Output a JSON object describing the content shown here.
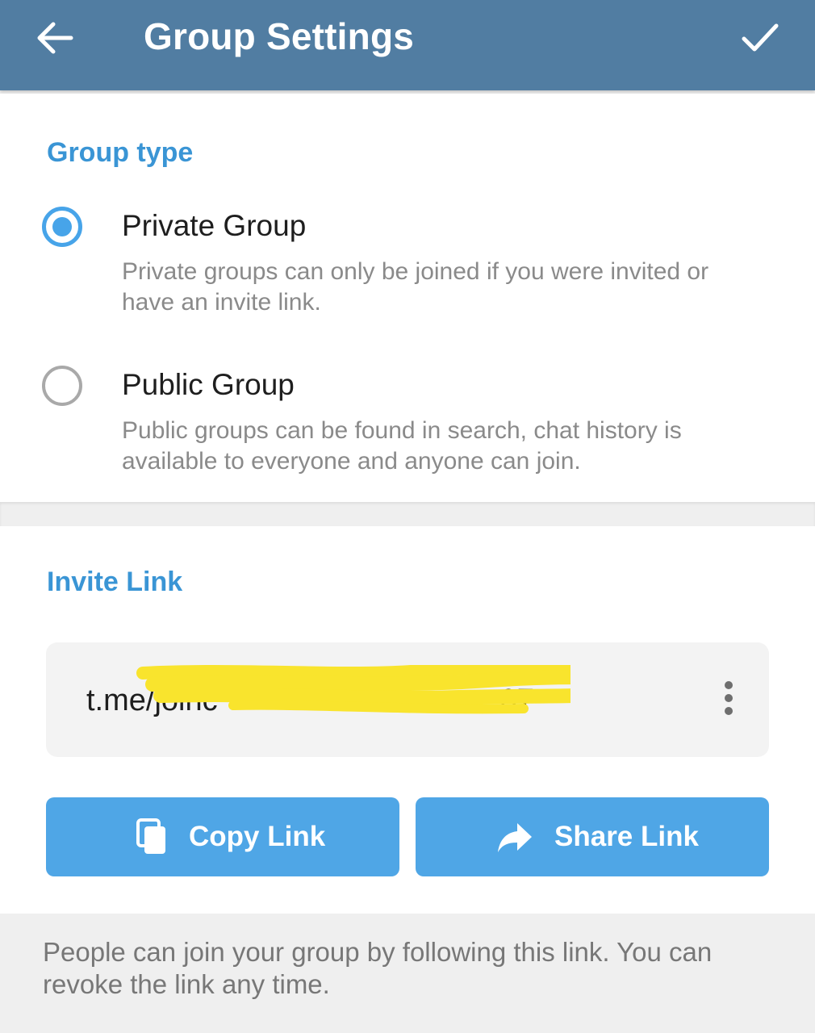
{
  "appbar": {
    "title": "Group Settings",
    "back_icon": "arrow-left-icon",
    "done_icon": "check-icon",
    "color": "#517da2"
  },
  "group_type": {
    "section_title": "Group type",
    "options": [
      {
        "label": "Private Group",
        "description": "Private groups can only be joined if you were invited or have an invite link.",
        "selected": true
      },
      {
        "label": "Public Group",
        "description": "Public groups can be found in search, chat history is available to everyone and anyone can join.",
        "selected": false
      }
    ]
  },
  "invite": {
    "section_title": "Invite Link",
    "link_text": "t.me/joinc",
    "link_suffix": "07",
    "redacted": true,
    "more_icon": "more-vertical-icon",
    "copy_label": "Copy Link",
    "copy_icon": "copy-icon",
    "share_label": "Share Link",
    "share_icon": "share-arrow-icon",
    "note": "People can join your group by following this link. You can revoke the link any time."
  },
  "colors": {
    "accent": "#3a95d5",
    "button": "#4fa6e6",
    "radio_selected": "#47a4e9",
    "redaction": "#f9e42d"
  }
}
